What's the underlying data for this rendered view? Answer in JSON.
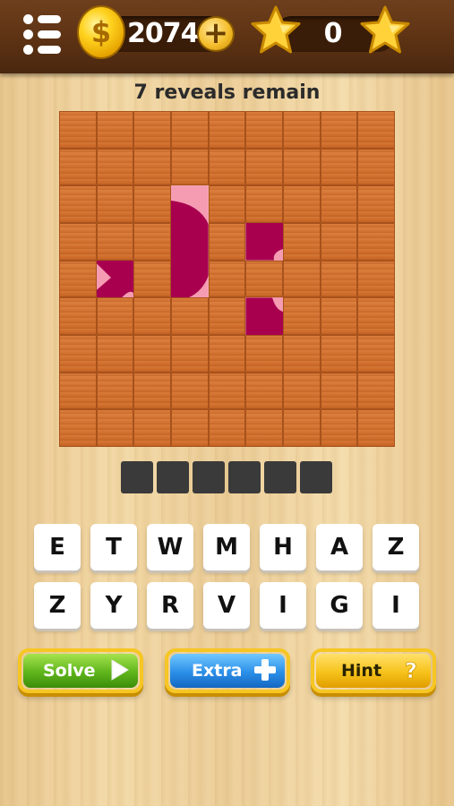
{
  "header": {
    "coins": "2074",
    "stars": "0"
  },
  "game": {
    "reveals_text": "7 reveals remain",
    "answer_length": 6,
    "grid_rows": 9,
    "grid_cols": 9,
    "revealed_tiles": [
      [
        2,
        3
      ],
      [
        3,
        3
      ],
      [
        3,
        5
      ],
      [
        4,
        1
      ],
      [
        4,
        3
      ],
      [
        5,
        5
      ]
    ]
  },
  "letters": [
    "E",
    "T",
    "W",
    "M",
    "H",
    "A",
    "Z",
    "Z",
    "Y",
    "R",
    "V",
    "I",
    "G",
    "I"
  ],
  "buttons": {
    "solve": "Solve",
    "extra": "Extra",
    "hint": "Hint"
  },
  "colors": {
    "tile_orange": "#d97a38",
    "image_magenta": "#a8004f",
    "image_pink": "#f59bb2",
    "solve_green": "#5fb51c",
    "extra_blue": "#2b8fe8",
    "hint_yellow": "#f7c21b"
  },
  "icons": {
    "menu": "menu-icon",
    "coin": "coin-icon",
    "add": "plus-icon",
    "star": "star-icon",
    "solve": "play-arrow-icon",
    "extra": "plus-icon",
    "hint": "question-mark-icon"
  }
}
